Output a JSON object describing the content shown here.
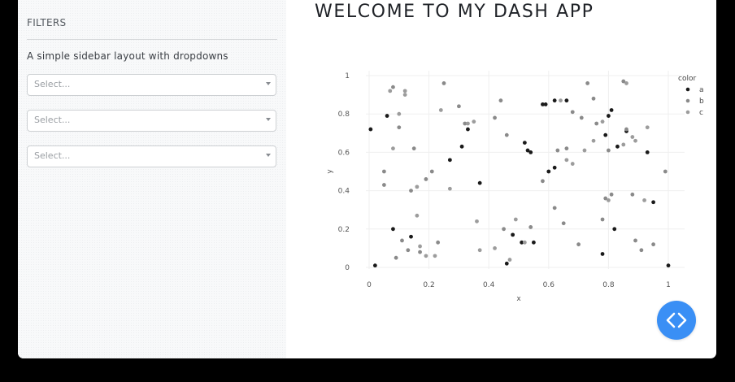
{
  "sidebar": {
    "heading": "FILTERS",
    "lead": "A simple sidebar layout with dropdowns",
    "dropdowns": [
      {
        "placeholder": "Select..."
      },
      {
        "placeholder": "Select..."
      },
      {
        "placeholder": "Select..."
      }
    ]
  },
  "main": {
    "title": "WELCOME TO MY DASH APP"
  },
  "code_button": {
    "icon": "code-icon"
  },
  "colors": {
    "fab": "#3a8ff5",
    "series_a": "#1a1a1a",
    "series_b": "#8a8a8a",
    "series_c": "#9c9c9c"
  },
  "chart_data": {
    "type": "scatter",
    "title": "",
    "xlabel": "x",
    "ylabel": "y",
    "xlim": [
      0,
      1
    ],
    "ylim": [
      0,
      1
    ],
    "grid": true,
    "legend_title": "color",
    "legend_position": "top-right",
    "x_ticks": [
      "0",
      "0.2",
      "0.4",
      "0.6",
      "0.8",
      "1"
    ],
    "y_ticks": [
      "0",
      "0.2",
      "0.4",
      "0.6",
      "0.8",
      "1"
    ],
    "series": [
      {
        "name": "a",
        "color": "#1a1a1a",
        "points": [
          [
            0.005,
            0.72
          ],
          [
            0.02,
            0.01
          ],
          [
            0.06,
            0.79
          ],
          [
            0.08,
            0.2
          ],
          [
            0.14,
            0.16
          ],
          [
            0.27,
            0.56
          ],
          [
            0.31,
            0.63
          ],
          [
            0.33,
            0.72
          ],
          [
            0.37,
            0.44
          ],
          [
            0.46,
            0.02
          ],
          [
            0.48,
            0.17
          ],
          [
            0.51,
            0.13
          ],
          [
            0.52,
            0.65
          ],
          [
            0.53,
            0.61
          ],
          [
            0.54,
            0.6
          ],
          [
            0.55,
            0.13
          ],
          [
            0.58,
            0.85
          ],
          [
            0.59,
            0.85
          ],
          [
            0.6,
            0.5
          ],
          [
            0.62,
            0.52
          ],
          [
            0.62,
            0.87
          ],
          [
            0.66,
            0.87
          ],
          [
            0.78,
            0.07
          ],
          [
            0.79,
            0.69
          ],
          [
            0.8,
            0.79
          ],
          [
            0.81,
            0.82
          ],
          [
            0.82,
            0.2
          ],
          [
            0.83,
            0.63
          ],
          [
            0.86,
            0.71
          ],
          [
            0.93,
            0.6
          ],
          [
            0.95,
            0.34
          ],
          [
            1.0,
            0.01
          ]
        ]
      },
      {
        "name": "b",
        "color": "#8a8a8a",
        "points": [
          [
            0.05,
            0.43
          ],
          [
            0.05,
            0.5
          ],
          [
            0.08,
            0.94
          ],
          [
            0.09,
            0.05
          ],
          [
            0.1,
            0.73
          ],
          [
            0.11,
            0.14
          ],
          [
            0.13,
            0.09
          ],
          [
            0.14,
            0.4
          ],
          [
            0.15,
            0.62
          ],
          [
            0.17,
            0.08
          ],
          [
            0.19,
            0.46
          ],
          [
            0.21,
            0.5
          ],
          [
            0.23,
            0.13
          ],
          [
            0.25,
            0.96
          ],
          [
            0.3,
            0.84
          ],
          [
            0.32,
            0.75
          ],
          [
            0.42,
            0.78
          ],
          [
            0.44,
            0.87
          ],
          [
            0.45,
            0.2
          ],
          [
            0.46,
            0.69
          ],
          [
            0.54,
            0.21
          ],
          [
            0.58,
            0.45
          ],
          [
            0.62,
            0.31
          ],
          [
            0.63,
            0.61
          ],
          [
            0.65,
            0.23
          ],
          [
            0.66,
            0.62
          ],
          [
            0.68,
            0.81
          ],
          [
            0.7,
            0.12
          ],
          [
            0.71,
            0.78
          ],
          [
            0.73,
            0.96
          ],
          [
            0.75,
            0.88
          ],
          [
            0.76,
            0.75
          ],
          [
            0.78,
            0.25
          ],
          [
            0.79,
            0.36
          ],
          [
            0.8,
            0.61
          ],
          [
            0.81,
            0.38
          ],
          [
            0.85,
            0.97
          ],
          [
            0.86,
            0.72
          ],
          [
            0.88,
            0.38
          ],
          [
            0.89,
            0.14
          ],
          [
            0.91,
            0.09
          ],
          [
            0.95,
            0.12
          ],
          [
            0.99,
            0.5
          ]
        ]
      },
      {
        "name": "c",
        "color": "#9c9c9c",
        "points": [
          [
            0.07,
            0.92
          ],
          [
            0.08,
            0.62
          ],
          [
            0.1,
            0.8
          ],
          [
            0.12,
            0.9
          ],
          [
            0.12,
            0.92
          ],
          [
            0.16,
            0.42
          ],
          [
            0.16,
            0.27
          ],
          [
            0.17,
            0.11
          ],
          [
            0.19,
            0.06
          ],
          [
            0.22,
            0.06
          ],
          [
            0.24,
            0.82
          ],
          [
            0.27,
            0.41
          ],
          [
            0.33,
            0.75
          ],
          [
            0.35,
            0.76
          ],
          [
            0.36,
            0.24
          ],
          [
            0.37,
            0.09
          ],
          [
            0.42,
            0.1
          ],
          [
            0.47,
            0.04
          ],
          [
            0.49,
            0.25
          ],
          [
            0.52,
            0.13
          ],
          [
            0.64,
            0.87
          ],
          [
            0.66,
            0.56
          ],
          [
            0.68,
            0.54
          ],
          [
            0.72,
            0.61
          ],
          [
            0.75,
            0.66
          ],
          [
            0.78,
            0.76
          ],
          [
            0.8,
            0.35
          ],
          [
            0.85,
            0.64
          ],
          [
            0.86,
            0.96
          ],
          [
            0.88,
            0.68
          ],
          [
            0.89,
            0.66
          ],
          [
            0.92,
            0.35
          ],
          [
            0.93,
            0.73
          ]
        ]
      }
    ]
  }
}
